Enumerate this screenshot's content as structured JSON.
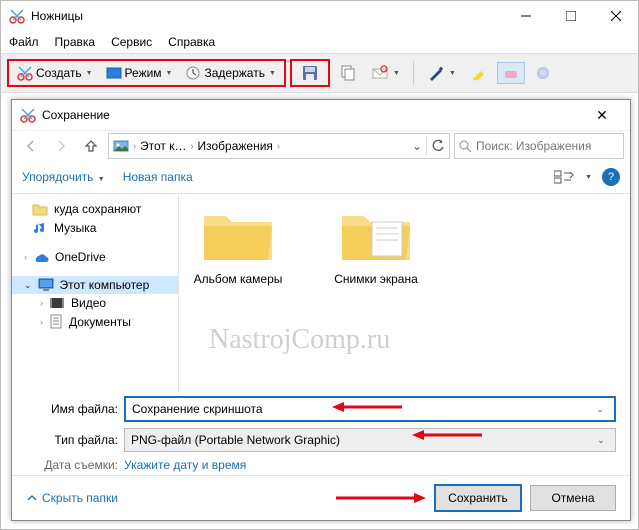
{
  "app": {
    "title": "Ножницы",
    "menus": [
      "Файл",
      "Правка",
      "Сервис",
      "Справка"
    ],
    "toolbar": {
      "create": "Создать",
      "mode": "Режим",
      "delay": "Задержать"
    }
  },
  "dialog": {
    "title": "Сохранение",
    "breadcrumb": {
      "pc": "Этот к…",
      "folder": "Изображения"
    },
    "search_placeholder": "Поиск: Изображения",
    "organize": "Упорядочить",
    "newfolder": "Новая папка",
    "tree": {
      "save_to": "куда сохраняют",
      "music": "Музыка",
      "onedrive": "OneDrive",
      "this_pc": "Этот компьютер",
      "video": "Видео",
      "documents": "Документы"
    },
    "content": {
      "item1": "Альбом камеры",
      "item2": "Снимки экрана"
    },
    "watermark": "NastrojComp.ru",
    "form": {
      "filename_label": "Имя файла:",
      "filename_value": "Сохранение скриншота",
      "filetype_label": "Тип файла:",
      "filetype_value": "PNG-файл (Portable Network Graphic)",
      "date_label": "Дата съемки:",
      "date_hint": "Укажите дату и время"
    },
    "hide_folders": "Скрыть папки",
    "save": "Сохранить",
    "cancel": "Отмена"
  }
}
